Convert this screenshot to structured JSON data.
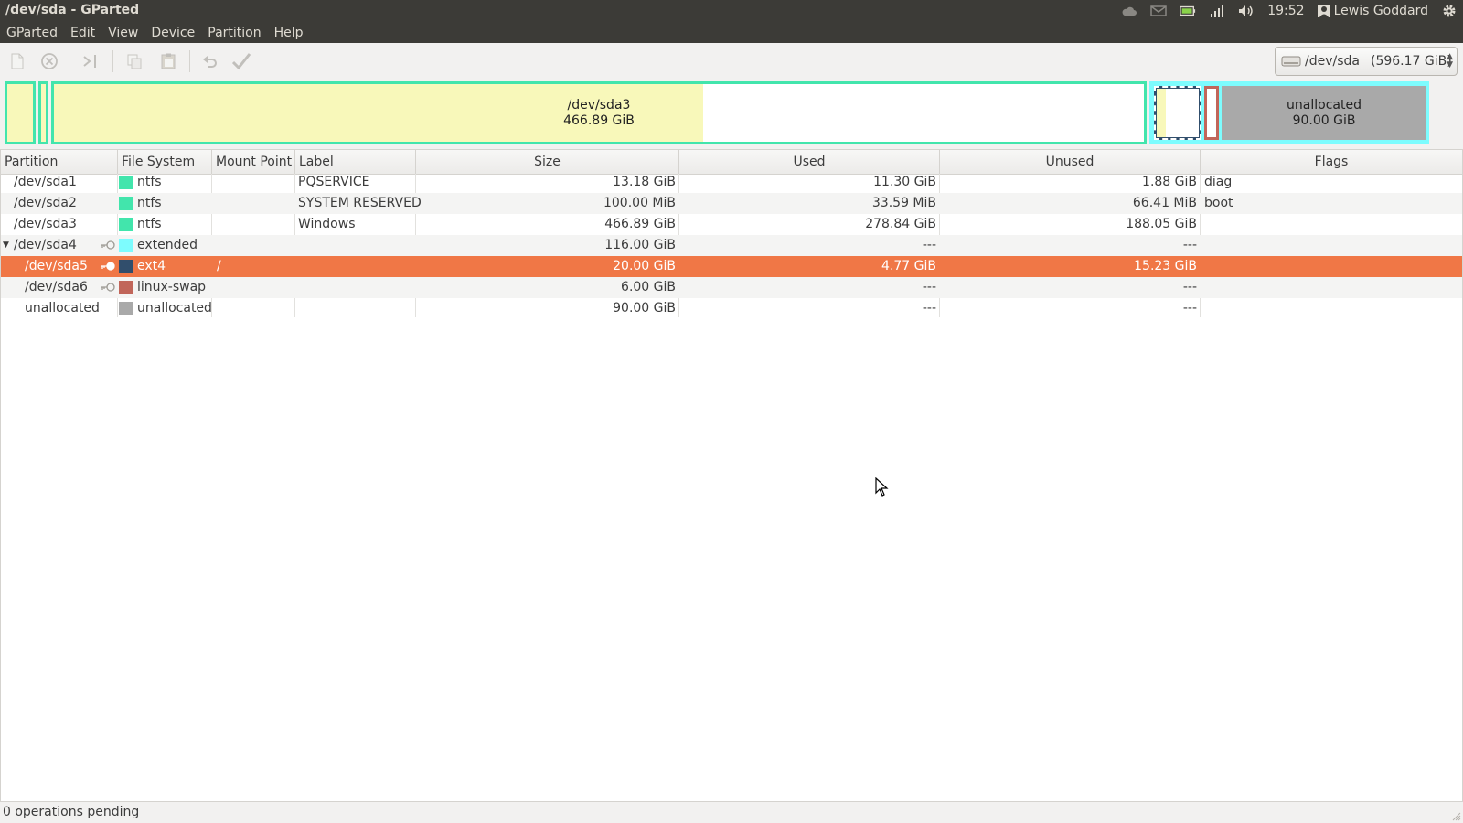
{
  "window": {
    "title": "/dev/sda - GParted"
  },
  "indicators": {
    "time": "19:52",
    "user": "Lewis Goddard",
    "icons": [
      "cloud-icon",
      "mail-icon",
      "battery-icon",
      "network-signal-icon",
      "volume-icon",
      "user-icon",
      "gear-icon"
    ]
  },
  "menu": [
    "GParted",
    "Edit",
    "View",
    "Device",
    "Partition",
    "Help"
  ],
  "toolbar": {
    "buttons": [
      "new-icon",
      "delete-icon",
      "resize-move-icon",
      "copy-icon",
      "paste-icon",
      "undo-icon",
      "apply-icon"
    ]
  },
  "device_selector": {
    "name": "/dev/sda",
    "size": "(596.17 GiB)"
  },
  "disk_map": {
    "segments": [
      {
        "name": "sda1",
        "kind": "ntfs",
        "share": 0.0221
      },
      {
        "name": "sda2",
        "kind": "ntfs",
        "share": 0.0002
      },
      {
        "name": "sda3",
        "kind": "ntfs",
        "share": 0.783,
        "label": "/dev/sda3",
        "size": "466.89 GiB",
        "used_fraction": 0.597
      },
      {
        "name": "sda4",
        "kind": "extended",
        "share": 0.1946
      },
      {
        "name": "unallocated",
        "kind": "unallocated",
        "label": "unallocated",
        "size": "90.00 GiB"
      }
    ],
    "colors": {
      "ntfs": "#42e5ac",
      "extended": "#7dfcfe",
      "ext4": "#314e6c",
      "linux_swap": "#c1665a",
      "unallocated": "#a9a9a9",
      "used": "#f8f8ba",
      "selected_border": "#2d2d2d"
    }
  },
  "table": {
    "columns": [
      "Partition",
      "File System",
      "Mount Point",
      "Label",
      "Size",
      "Used",
      "Unused",
      "Flags"
    ],
    "rows": [
      {
        "partition": "/dev/sda1",
        "fs": "ntfs",
        "fs_color": "#42e5ac",
        "mount": "",
        "label": "PQSERVICE",
        "size": "13.18 GiB",
        "used": "11.30 GiB",
        "unused": "1.88 GiB",
        "flags": "diag",
        "indent": 0,
        "key": false,
        "expander": false,
        "selected": false
      },
      {
        "partition": "/dev/sda2",
        "fs": "ntfs",
        "fs_color": "#42e5ac",
        "mount": "",
        "label": "SYSTEM RESERVED",
        "size": "100.00 MiB",
        "used": "33.59 MiB",
        "unused": "66.41 MiB",
        "flags": "boot",
        "indent": 0,
        "key": false,
        "expander": false,
        "selected": false
      },
      {
        "partition": "/dev/sda3",
        "fs": "ntfs",
        "fs_color": "#42e5ac",
        "mount": "",
        "label": "Windows",
        "size": "466.89 GiB",
        "used": "278.84 GiB",
        "unused": "188.05 GiB",
        "flags": "",
        "indent": 0,
        "key": false,
        "expander": false,
        "selected": false
      },
      {
        "partition": "/dev/sda4",
        "fs": "extended",
        "fs_color": "#7dfcfe",
        "mount": "",
        "label": "",
        "size": "116.00 GiB",
        "used": "---",
        "unused": "---",
        "flags": "",
        "indent": 0,
        "key": true,
        "expander": true,
        "selected": false
      },
      {
        "partition": "/dev/sda5",
        "fs": "ext4",
        "fs_color": "#314e6c",
        "mount": "/",
        "label": "",
        "size": "20.00 GiB",
        "used": "4.77 GiB",
        "unused": "15.23 GiB",
        "flags": "",
        "indent": 1,
        "key": true,
        "expander": false,
        "selected": true
      },
      {
        "partition": "/dev/sda6",
        "fs": "linux-swap",
        "fs_color": "#c1665a",
        "mount": "",
        "label": "",
        "size": "6.00 GiB",
        "used": "---",
        "unused": "---",
        "flags": "",
        "indent": 1,
        "key": true,
        "expander": false,
        "selected": false
      },
      {
        "partition": "unallocated",
        "fs": "unallocated",
        "fs_color": "#a9a9a9",
        "mount": "",
        "label": "",
        "size": "90.00 GiB",
        "used": "---",
        "unused": "---",
        "flags": "",
        "indent": 1,
        "key": false,
        "expander": false,
        "selected": false
      }
    ]
  },
  "status": {
    "text": "0 operations pending"
  }
}
